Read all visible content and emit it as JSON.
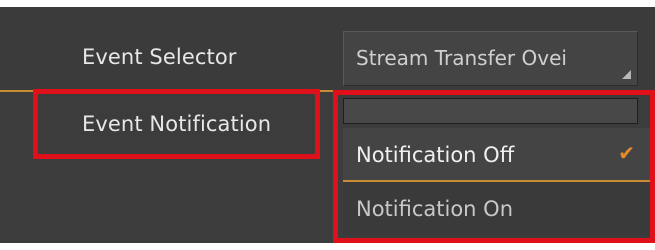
{
  "rows": {
    "event_selector": {
      "label": "Event Selector",
      "value": "Stream Transfer Ovei"
    },
    "event_notification": {
      "label": "Event Notification",
      "options": [
        {
          "label": "Notification Off",
          "selected": true
        },
        {
          "label": "Notification On",
          "selected": false
        }
      ],
      "check_glyph": "✔"
    }
  },
  "colors": {
    "accent": "#c98a35",
    "check": "#e88a2a",
    "highlight": "#e0101a",
    "background": "#3a3a3a"
  },
  "icons": {
    "resize_grip": "resize-grip-icon",
    "check": "checkmark-icon"
  }
}
